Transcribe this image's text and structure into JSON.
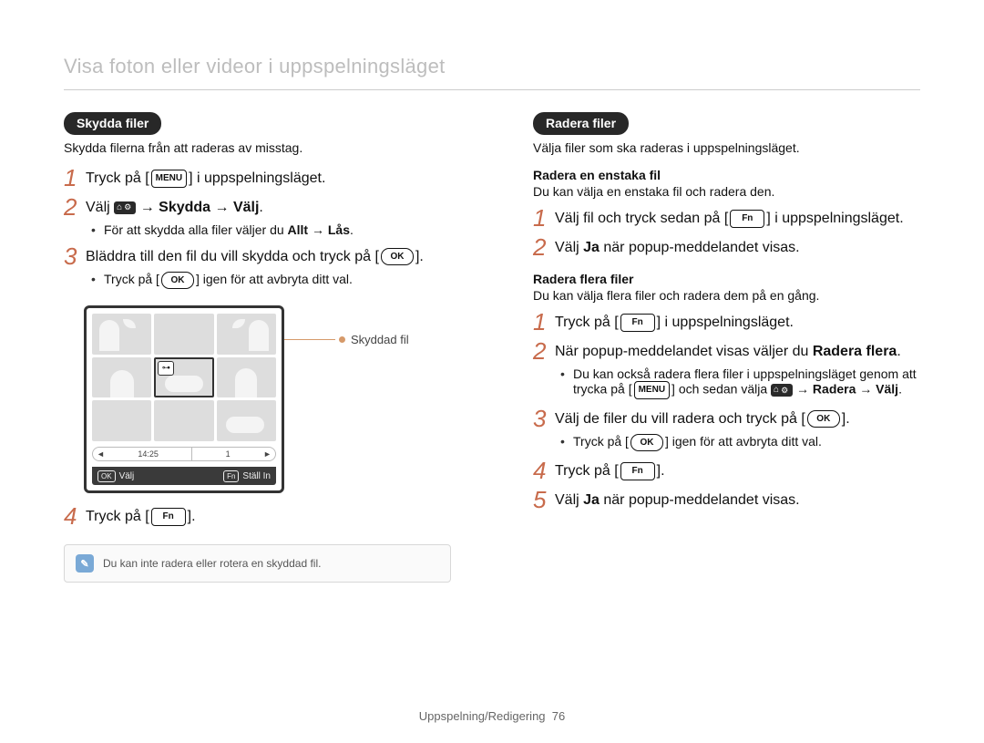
{
  "header": {
    "title": "Visa foton eller videor i uppspelningsläget"
  },
  "icons": {
    "menu": "MENU",
    "ok": "OK",
    "fn": "Fn",
    "settings": "⌂",
    "gear": "⚙"
  },
  "left": {
    "pill": "Skydda filer",
    "intro": "Skydda filerna från att raderas av misstag.",
    "steps": {
      "s1_a": "Tryck på [",
      "s1_b": "] i uppspelningsläget.",
      "s2_a": "Välj ",
      "s2_b": " → Skydda → Välj",
      "s2_dot": ".",
      "s2_sub_a": "För att skydda alla filer väljer du ",
      "s2_sub_b": "Allt → Lås",
      "s2_sub_c": ".",
      "s3_a": "Bläddra till den fil du vill skydda och tryck på [",
      "s3_b": "].",
      "s3_sub_a": "Tryck på [",
      "s3_sub_b": "] igen för att avbryta ditt val.",
      "s4_a": "Tryck på [",
      "s4_b": "]."
    },
    "illus": {
      "callout": "Skyddad fil",
      "bar_time": "14:25",
      "bar_num": "1",
      "bottom_ok": "OK",
      "bottom_select": "Välj",
      "bottom_fn": "Fn",
      "bottom_set": "Ställ In",
      "key_glyph": "⊶"
    },
    "note": "Du kan inte radera eller rotera en skyddad fil."
  },
  "right": {
    "pill": "Radera filer",
    "intro": "Välja filer som ska raderas i uppspelningsläget.",
    "single": {
      "head": "Radera en enstaka fil",
      "text": "Du kan välja en enstaka fil och radera den.",
      "s1_a": "Välj fil och tryck sedan på [",
      "s1_b": "] i uppspelningsläget.",
      "s2_a": "Välj ",
      "s2_b": "Ja",
      "s2_c": " när popup-meddelandet visas."
    },
    "multi": {
      "head": "Radera flera filer",
      "text": "Du kan välja flera filer och radera dem på en gång.",
      "s1_a": "Tryck på [",
      "s1_b": "] i uppspelningsläget.",
      "s2_a": "När popup-meddelandet visas väljer du ",
      "s2_b": "Radera flera",
      "s2_c": ".",
      "s2_sub_a": "Du kan också radera flera filer i uppspelningsläget genom att trycka på [",
      "s2_sub_b": "] och sedan välja ",
      "s2_sub_c": " → Radera → Välj",
      "s2_sub_d": ".",
      "s3_a": "Välj de filer du vill radera och tryck på [",
      "s3_b": "].",
      "s3_sub_a": "Tryck på [",
      "s3_sub_b": "] igen för att avbryta ditt val.",
      "s4_a": "Tryck på [",
      "s4_b": "].",
      "s5_a": "Välj ",
      "s5_b": "Ja",
      "s5_c": " när popup-meddelandet visas."
    }
  },
  "footer": {
    "section": "Uppspelning/Redigering",
    "page": "76"
  }
}
